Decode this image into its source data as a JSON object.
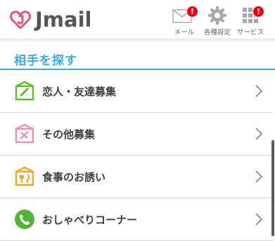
{
  "header": {
    "logo_text": "Jmail",
    "buttons": [
      {
        "label": "メール",
        "badge": "!",
        "icon": "mail-icon"
      },
      {
        "label": "各種設定",
        "badge": "",
        "icon": "gear-icon"
      },
      {
        "label": "サービス",
        "badge": "!",
        "icon": "grid-icon"
      }
    ]
  },
  "section": {
    "title": "相手を探す"
  },
  "items": [
    {
      "label": "恋人・友達募集",
      "icon": "notebook-pencil-icon",
      "color": "#5cbf2a"
    },
    {
      "label": "その他募集",
      "icon": "notebook-tools-icon",
      "color": "#f08fb5"
    },
    {
      "label": "食事のお誘い",
      "icon": "dining-icon",
      "color": "#f5a623"
    },
    {
      "label": "おしゃべりコーナー",
      "icon": "phone-icon",
      "color": "#52b53a"
    }
  ],
  "colors": {
    "accent": "#3aa8e0",
    "badge": "#e60012",
    "logo": "#e4566f"
  }
}
